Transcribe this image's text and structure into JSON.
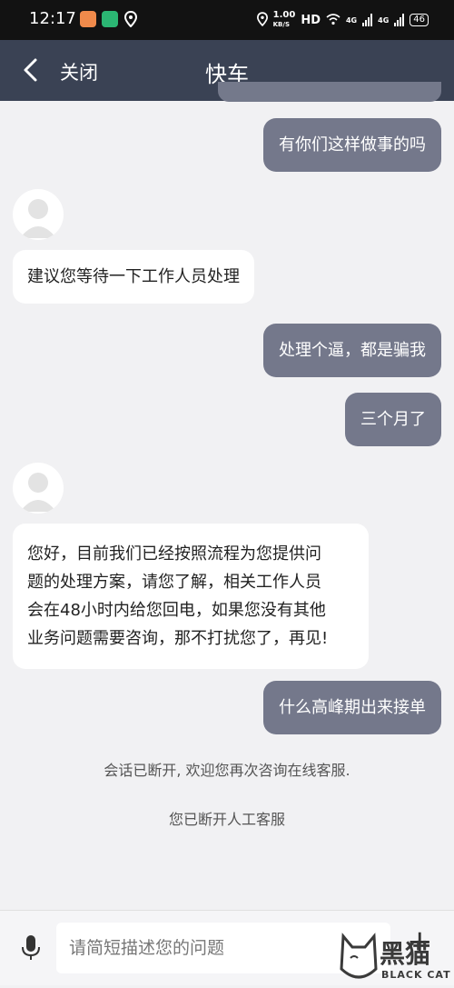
{
  "status_bar": {
    "time": "12:17",
    "speed": "1.00",
    "speed_unit": "KB/S",
    "hd": "HD",
    "net1": "4G",
    "net2": "4G",
    "battery": "46"
  },
  "header": {
    "back_icon": "chevron-left-icon",
    "close_label": "关闭",
    "title": "快车"
  },
  "messages": [
    {
      "side": "out",
      "text": "有你们这样做事的吗"
    },
    {
      "side": "in",
      "text": "建议您等待一下工作人员处理"
    },
    {
      "side": "out",
      "text": "处理个逼，都是骗我"
    },
    {
      "side": "out",
      "text": "三个月了"
    },
    {
      "side": "in",
      "lines": [
        "您好，目前我们已经按照流程为您提供问",
        "题的处理方案，请您了解，相关工作人员",
        "会在48小时内给您回电，如果您没有其他",
        "业务问题需要咨询，那不打扰您了，再见!"
      ]
    },
    {
      "side": "out",
      "text": "什么高峰期出来接单"
    }
  ],
  "system": {
    "session_ended": "会话已断开, 欢迎您再次咨询在线客服.",
    "disconnected": "您已断开人工客服"
  },
  "input": {
    "placeholder": "请简短描述您的问题",
    "mic_icon": "microphone-icon",
    "plus_icon": "plus-icon"
  },
  "watermark": {
    "text": "黑猫",
    "sub": "BLACK CAT"
  },
  "colors": {
    "header_bg": "#3a4254",
    "outgoing_bubble": "#74788b",
    "incoming_bubble": "#ffffff",
    "chat_bg": "#f1f1f3"
  }
}
